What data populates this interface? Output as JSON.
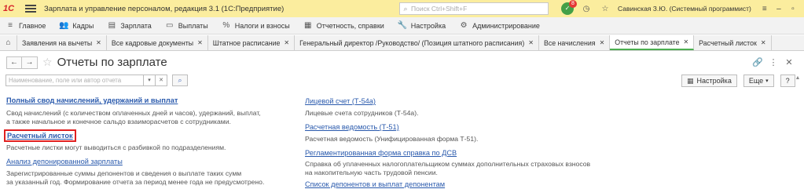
{
  "app": {
    "logo": "1С",
    "title": "Зарплата и управление персоналом, редакция 3.1  (1С:Предприятие)",
    "search_placeholder": "Поиск Ctrl+Shift+F",
    "notif_count": "8",
    "user": "Савинская З.Ю. (Системный программист)"
  },
  "sections": [
    {
      "label": "Главное",
      "icon": "≡"
    },
    {
      "label": "Кадры",
      "icon": "👥"
    },
    {
      "label": "Зарплата",
      "icon": "▤"
    },
    {
      "label": "Выплаты",
      "icon": "▭"
    },
    {
      "label": "Налоги и взносы",
      "icon": "%"
    },
    {
      "label": "Отчетность, справки",
      "icon": "▦"
    },
    {
      "label": "Настройка",
      "icon": "🔧"
    },
    {
      "label": "Администрирование",
      "icon": "⚙"
    }
  ],
  "tabs": [
    "Заявления на вычеты",
    "Все кадровые документы",
    "Штатное расписание",
    "Генеральный директор /Руководство/ (Позиция штатного расписания)",
    "Все начисления",
    "Отчеты по зарплате",
    "Расчетный листок"
  ],
  "form": {
    "title": "Отчеты по зарплате",
    "filter_placeholder": "Наименование, поле или автор отчета",
    "settings_label": "Настройка",
    "more_label": "Еще",
    "help_label": "?"
  },
  "reports_left": [
    {
      "title": "Полный свод начислений, удержаний и выплат",
      "desc": [
        "Свод начислений (с количеством оплаченных дней и часов), удержаний, выплат,",
        "а также начальное и конечное сальдо взаиморасчетов с сотрудниками."
      ]
    },
    {
      "title": "Расчетный листок",
      "desc": [
        "Расчетные листки могут выводиться с разбивкой по подразделениям."
      ]
    },
    {
      "title": "Анализ депонированной зарплаты",
      "desc": [
        "Зарегистрированные суммы депонентов и сведения о выплате таких сумм",
        "за указанный год. Формирование отчета за период менее года не предусмотрено."
      ]
    }
  ],
  "reports_right": [
    {
      "title": "Лицевой счет (Т-54а)",
      "desc": [
        "Лицевые счета сотрудников (Т-54а)."
      ]
    },
    {
      "title": "Расчетная ведомость (Т-51)",
      "desc": [
        "Расчетная ведомость (Унифицированная форма Т-51)."
      ]
    },
    {
      "title": "Регламентированная форма справка по ДСВ",
      "desc": [
        "Справка об уплаченных налогоплательщиком суммах дополнительных страховых взносов",
        "на накопительную часть трудовой пенсии."
      ]
    },
    {
      "title": "Список депонентов и выплат депонентам",
      "desc": []
    }
  ]
}
